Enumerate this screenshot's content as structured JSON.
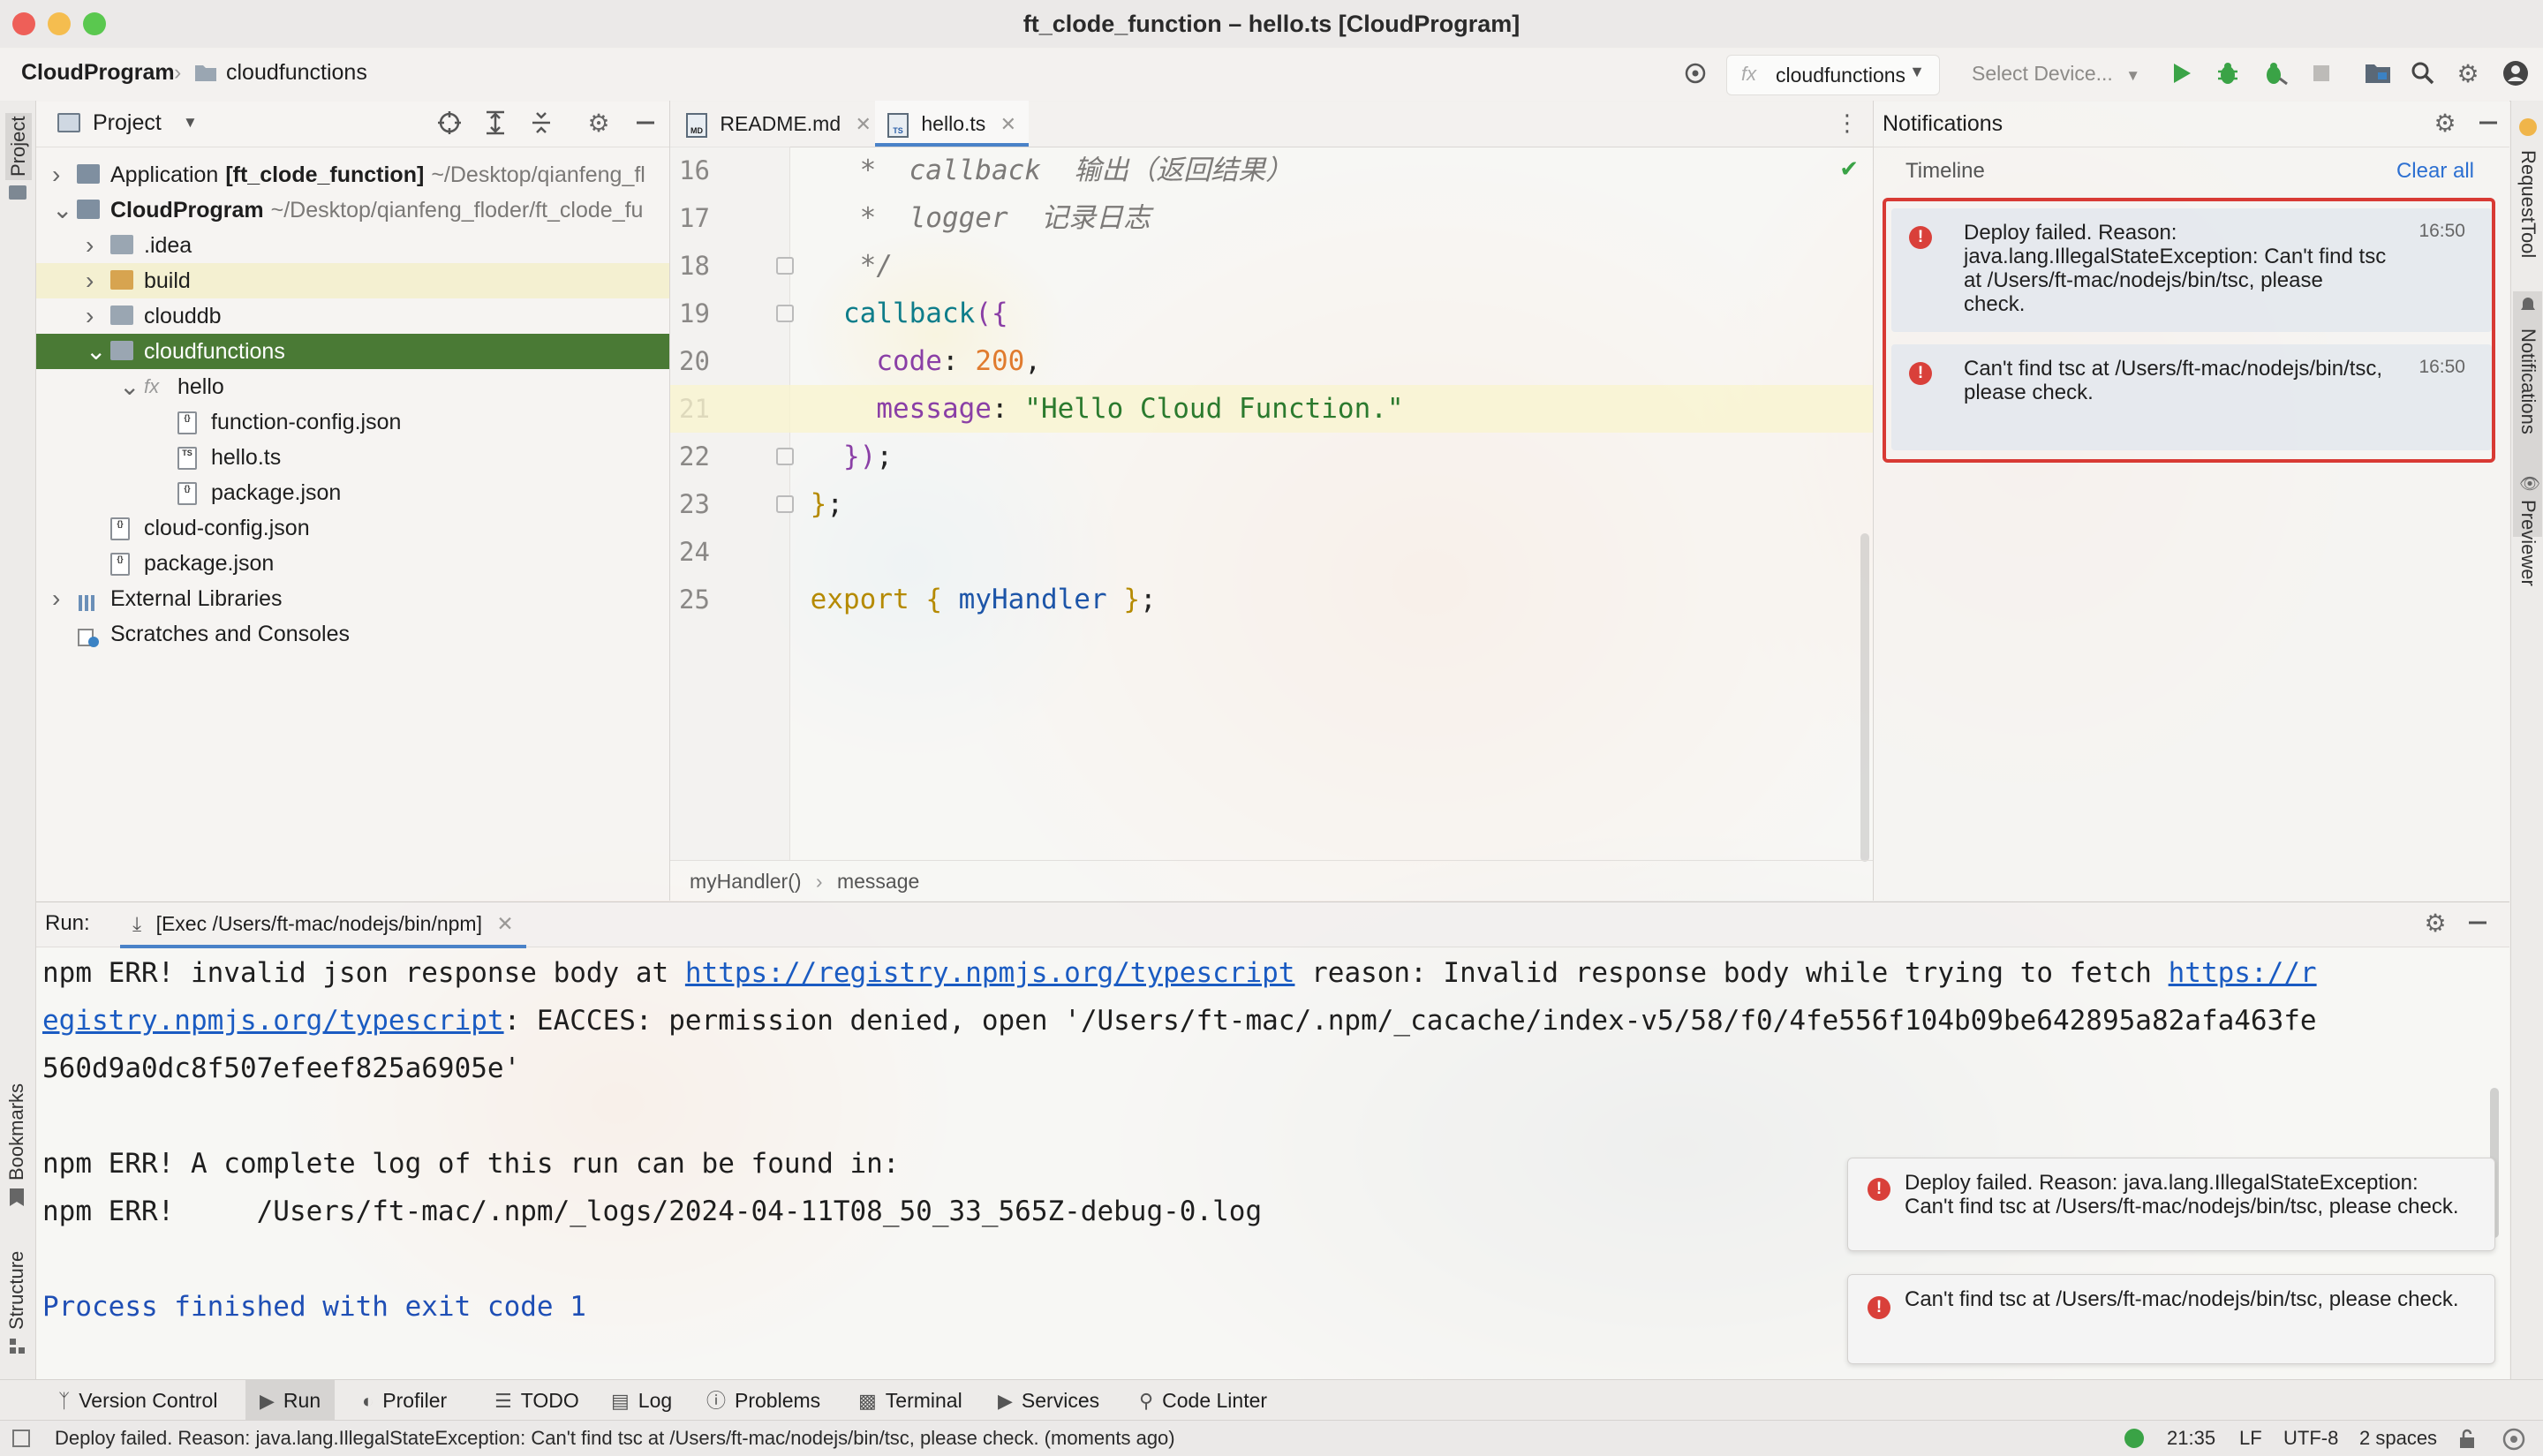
{
  "window": {
    "title": "ft_clode_function – hello.ts [CloudProgram]"
  },
  "nav": {
    "project": "CloudProgram",
    "folder": "cloudfunctions",
    "run_config": "cloudfunctions",
    "device_placeholder": "Select Device..."
  },
  "left_tabs": {
    "project": "Project",
    "bookmarks": "Bookmarks",
    "structure": "Structure"
  },
  "right_tabs": {
    "request_tool": "RequestTool",
    "notifications": "Notifications",
    "previewer": "Previewer"
  },
  "project_panel": {
    "title": "Project",
    "tree": [
      {
        "label": "Application",
        "bold": "[ft_clode_function]",
        "path": "~/Desktop/qianfeng_fl",
        "depth": 0,
        "arrow": "›",
        "icon": "module"
      },
      {
        "label": "CloudProgram",
        "bold": "",
        "path": "~/Desktop/qianfeng_floder/ft_clode_fu",
        "depth": 0,
        "arrow": "˅",
        "icon": "module",
        "strong": true
      },
      {
        "label": ".idea",
        "depth": 1,
        "arrow": "›",
        "icon": "folder"
      },
      {
        "label": "build",
        "depth": 1,
        "arrow": "›",
        "icon": "folder-build",
        "highlight": true
      },
      {
        "label": "clouddb",
        "depth": 1,
        "arrow": "›",
        "icon": "folder"
      },
      {
        "label": "cloudfunctions",
        "depth": 1,
        "arrow": "˅",
        "icon": "folder",
        "selected": true
      },
      {
        "label": "hello",
        "depth": 2,
        "arrow": "˅",
        "icon": "fx"
      },
      {
        "label": "function-config.json",
        "depth": 3,
        "arrow": "",
        "icon": "json"
      },
      {
        "label": "hello.ts",
        "depth": 3,
        "arrow": "",
        "icon": "ts"
      },
      {
        "label": "package.json",
        "depth": 3,
        "arrow": "",
        "icon": "json"
      },
      {
        "label": "cloud-config.json",
        "depth": 1,
        "arrow": "",
        "icon": "json"
      },
      {
        "label": "package.json",
        "depth": 1,
        "arrow": "",
        "icon": "json"
      },
      {
        "label": "External Libraries",
        "depth": 0,
        "arrow": "›",
        "icon": "libs"
      },
      {
        "label": "Scratches and Consoles",
        "depth": 0,
        "arrow": "",
        "icon": "scratch"
      }
    ]
  },
  "editor": {
    "tabs": [
      {
        "label": "README.md",
        "icon": "MD"
      },
      {
        "label": "hello.ts",
        "icon": "TS",
        "active": true
      }
    ],
    "lines": [
      {
        "n": "16",
        "parts": [
          [
            "c-gray",
            "    *  callback  "
          ],
          [
            "c-gray",
            "输出（返回结果）"
          ]
        ]
      },
      {
        "n": "17",
        "parts": [
          [
            "c-gray",
            "    *  logger  "
          ],
          [
            "c-gray",
            "记录日志"
          ]
        ]
      },
      {
        "n": "18",
        "parts": [
          [
            "c-gray",
            "    */"
          ]
        ]
      },
      {
        "n": "19",
        "parts": [
          [
            "c-teal",
            "   callback"
          ],
          [
            "c-purple",
            "({"
          ]
        ]
      },
      {
        "n": "20",
        "parts": [
          [
            "c-purple",
            "     code"
          ],
          [
            "c-dark",
            ": "
          ],
          [
            "c-orange",
            "200"
          ],
          [
            "c-dark",
            ","
          ]
        ]
      },
      {
        "n": "21",
        "parts": [
          [
            "c-purple",
            "     message"
          ],
          [
            "c-dark",
            ": "
          ],
          [
            "c-green",
            "\"Hello Cloud Function.\""
          ]
        ],
        "current": true
      },
      {
        "n": "22",
        "parts": [
          [
            "c-purple",
            "   })"
          ],
          [
            "c-dark",
            ";"
          ]
        ]
      },
      {
        "n": "23",
        "parts": [
          [
            "c-yellow",
            " }"
          ],
          [
            "c-dark",
            ";"
          ]
        ]
      },
      {
        "n": "24",
        "parts": [
          [
            "c-dark",
            " "
          ]
        ]
      },
      {
        "n": "25",
        "parts": [
          [
            "c-yellow",
            " export"
          ],
          [
            "c-dark",
            " "
          ],
          [
            "c-yellow",
            "{"
          ],
          [
            "c-blue",
            " myHandler "
          ],
          [
            "c-yellow",
            "}"
          ],
          [
            "c-dark",
            ";"
          ]
        ]
      }
    ],
    "breadcrumb": [
      "myHandler()",
      "message"
    ]
  },
  "notifications": {
    "title": "Notifications",
    "timeline": "Timeline",
    "clear_all": "Clear all",
    "items": [
      {
        "message": "Deploy failed. Reason: java.lang.IllegalStateException: Can't find tsc at /Users/ft-mac/nodejs/bin/tsc, please check.",
        "time": "16:50"
      },
      {
        "message": "Can't find tsc at /Users/ft-mac/nodejs/bin/tsc, please check.",
        "time": "16:50"
      }
    ]
  },
  "run_panel": {
    "label": "Run:",
    "tab": "[Exec /Users/ft-mac/nodejs/bin/npm]",
    "console": {
      "l1a": "npm ERR! invalid json response body at ",
      "l1link": "https://registry.npmjs.org/typescript",
      "l1b": " reason: Invalid response body while trying to fetch ",
      "l1link2": "https://r",
      "l2link": "egistry.npmjs.org/typescript",
      "l2b": ": EACCES: permission denied, open '/Users/ft-mac/.npm/_cacache/index-v5/58/f0/4fe556f104b09be642895a82afa463fe",
      "l3": "560d9a0dc8f507efeef825a6905e'",
      "l4": "npm ERR! A complete log of this run can be found in:",
      "l5": "npm ERR!     /Users/ft-mac/.npm/_logs/2024-04-11T08_50_33_565Z-debug-0.log",
      "l6": "Process finished with exit code 1"
    },
    "toasts": [
      "Deploy failed. Reason: java.lang.IllegalStateException: Can't find tsc at /Users/ft-mac/nodejs/bin/tsc, please check.",
      "Can't find tsc at /Users/ft-mac/nodejs/bin/tsc, please check."
    ]
  },
  "tool_tabs": [
    "Version Control",
    "Run",
    "Profiler",
    "TODO",
    "Log",
    "Problems",
    "Terminal",
    "Services",
    "Code Linter"
  ],
  "status": {
    "message": "Deploy failed. Reason: java.lang.IllegalStateException: Can't find tsc at /Users/ft-mac/nodejs/bin/tsc, please check.  (moments ago)",
    "position": "21:35",
    "line_sep": "LF",
    "encoding": "UTF-8",
    "indent": "2 spaces"
  },
  "colors": {
    "selection": "#4a7a35",
    "error": "#d9403a",
    "frame": "#d83a34",
    "link": "#1a5bc2"
  }
}
